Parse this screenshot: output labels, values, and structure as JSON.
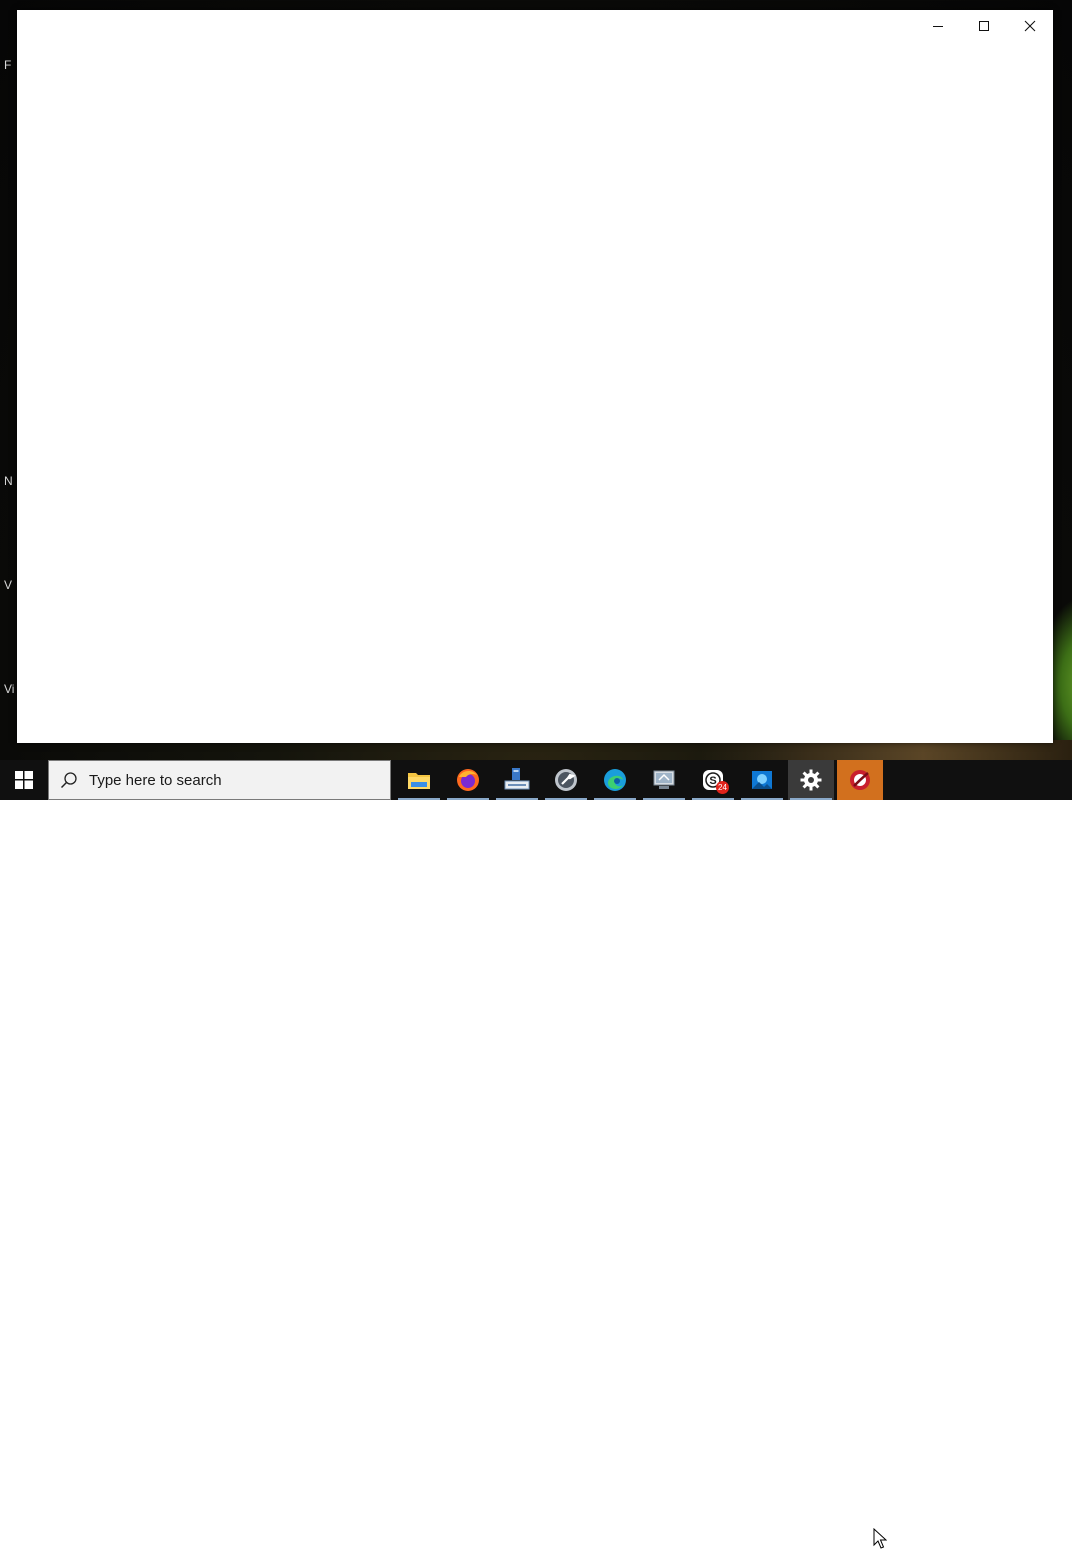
{
  "window": {
    "controls": {
      "minimize": "minimize",
      "maximize": "maximize",
      "close": "close"
    }
  },
  "desktop": {
    "edge_letters": [
      "F",
      "N",
      "V",
      "Vi"
    ]
  },
  "taskbar": {
    "search": {
      "placeholder": "Type here to search"
    },
    "apps": [
      {
        "name": "File Explorer",
        "icon": "folder-icon",
        "running": true
      },
      {
        "name": "Firefox",
        "icon": "firefox-icon",
        "running": true
      },
      {
        "name": "Network app",
        "icon": "network-computer-icon",
        "running": true
      },
      {
        "name": "Tools",
        "icon": "wrench-tool-icon",
        "running": true
      },
      {
        "name": "Microsoft Edge",
        "icon": "edge-icon",
        "running": true
      },
      {
        "name": "Remote desktop",
        "icon": "remote-desktop-icon",
        "running": true
      },
      {
        "name": "Skype",
        "icon": "skype-icon",
        "running": true,
        "badge": "24"
      },
      {
        "name": "Photos",
        "icon": "photos-icon",
        "running": true
      },
      {
        "name": "Settings",
        "icon": "gear-icon",
        "running": true,
        "active": true
      },
      {
        "name": "Red app",
        "icon": "red-circle-app-icon",
        "running": true,
        "highlighted": true
      }
    ]
  },
  "colors": {
    "taskbar_bg": "#101010",
    "window_bg": "#ffffff",
    "active_orange": "#d2701e",
    "running_underline": "#8aa9c9"
  }
}
